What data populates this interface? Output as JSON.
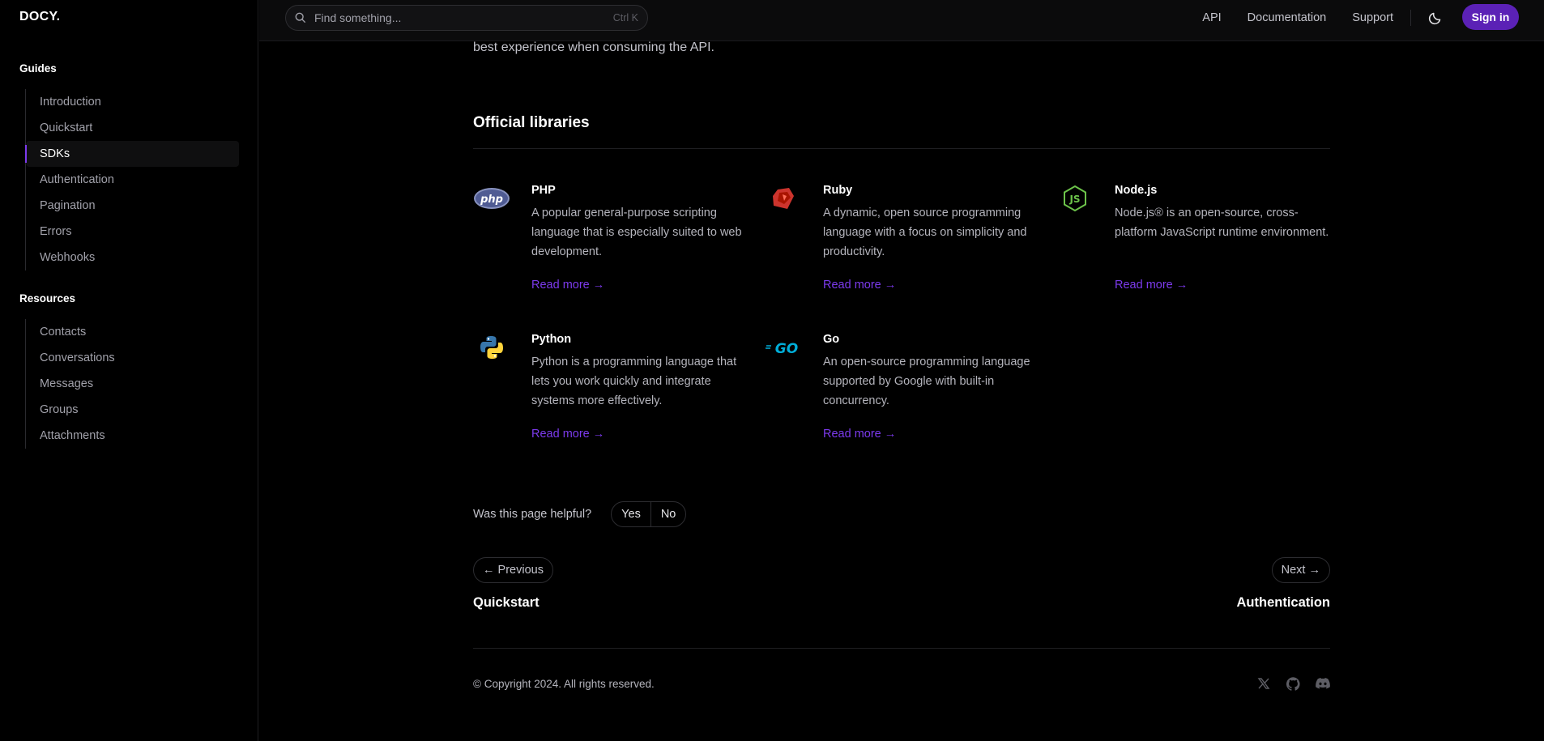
{
  "brand": "DOCY.",
  "sidebar": {
    "groups": [
      {
        "title": "Guides",
        "items": [
          "Introduction",
          "Quickstart",
          "SDKs",
          "Authentication",
          "Pagination",
          "Errors",
          "Webhooks"
        ],
        "active": "SDKs"
      },
      {
        "title": "Resources",
        "items": [
          "Contacts",
          "Conversations",
          "Messages",
          "Groups",
          "Attachments"
        ]
      }
    ]
  },
  "topbar": {
    "search_placeholder": "Find something...",
    "search_shortcut": "Ctrl K",
    "links": [
      "API",
      "Documentation",
      "Support"
    ],
    "sign_in": "Sign in"
  },
  "main": {
    "intro_tail": "best experience when consuming the API.",
    "section_title": "Official libraries",
    "libraries": [
      {
        "name": "PHP",
        "icon": "php-icon",
        "description": "A popular general-purpose scripting language that is especially suited to web development.",
        "link": "Read more"
      },
      {
        "name": "Ruby",
        "icon": "ruby-icon",
        "description": "A dynamic, open source programming language with a focus on simplicity and productivity.",
        "link": "Read more"
      },
      {
        "name": "Node.js",
        "icon": "nodejs-icon",
        "description": "Node.js® is an open-source, cross-platform JavaScript runtime environment.",
        "link": "Read more"
      },
      {
        "name": "Python",
        "icon": "python-icon",
        "description": "Python is a programming language that lets you work quickly and integrate systems more effectively.",
        "link": "Read more"
      },
      {
        "name": "Go",
        "icon": "go-icon",
        "description": "An open-source programming language supported by Google with built-in concurrency.",
        "link": "Read more"
      }
    ],
    "helpful": {
      "label": "Was this page helpful?",
      "yes": "Yes",
      "no": "No"
    },
    "pager": {
      "previous_label": "Previous",
      "previous_title": "Quickstart",
      "next_label": "Next",
      "next_title": "Authentication"
    },
    "copyright": "© Copyright 2024. All rights reserved.",
    "social": [
      "x-icon",
      "github-icon",
      "discord-icon"
    ]
  },
  "colors": {
    "accent": "#7c3aed",
    "signin_bg": "#5b21b6",
    "background": "#000000"
  }
}
